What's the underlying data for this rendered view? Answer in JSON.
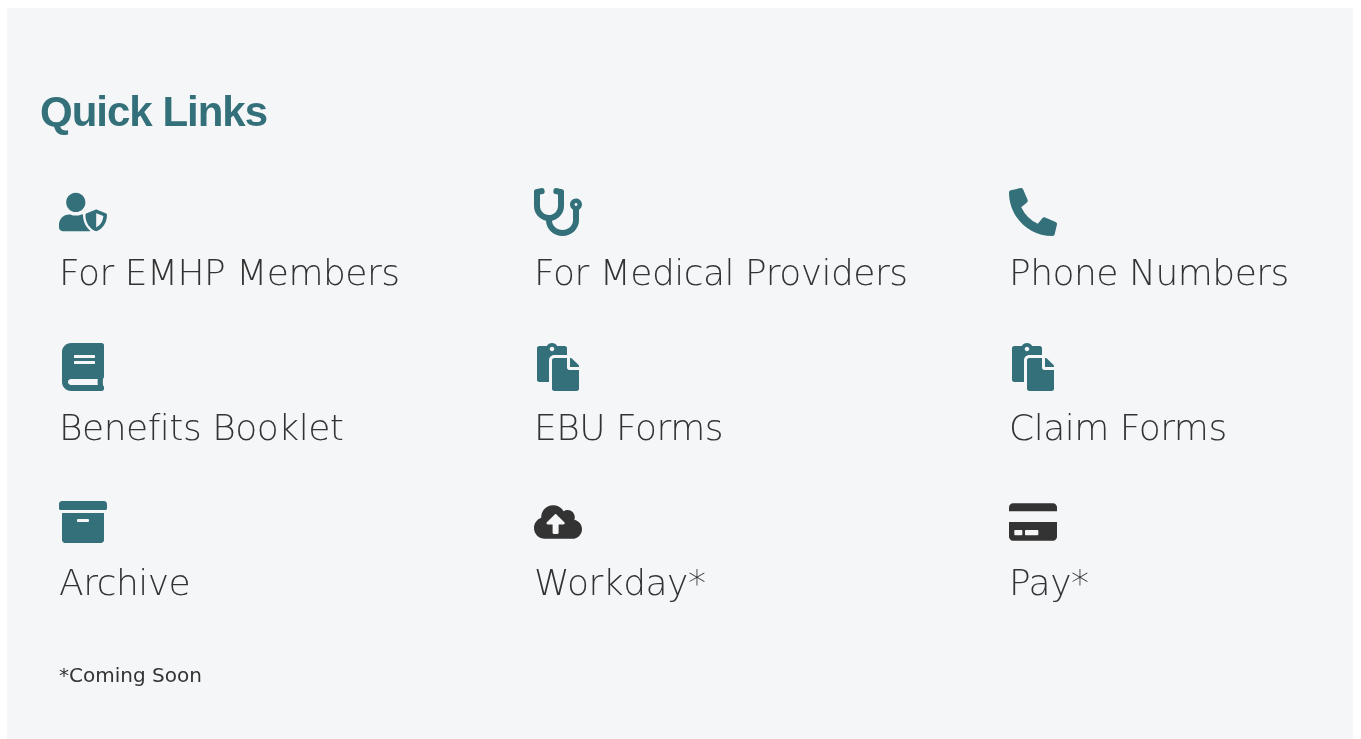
{
  "title": "Quick Links",
  "links": [
    {
      "label": "For EMHP Members",
      "kind": "user-shield",
      "color": "#33707a"
    },
    {
      "label": "For Medical Providers",
      "kind": "stethoscope",
      "color": "#33707a"
    },
    {
      "label": "Phone Numbers",
      "kind": "phone",
      "color": "#33707a"
    },
    {
      "label": "Benefits Booklet",
      "kind": "book",
      "color": "#33707a"
    },
    {
      "label": "EBU Forms",
      "kind": "clipboard",
      "color": "#33707a"
    },
    {
      "label": "Claim Forms",
      "kind": "clipboard",
      "color": "#33707a"
    },
    {
      "label": "Archive",
      "kind": "archive",
      "color": "#33707a"
    },
    {
      "label": "Workday*",
      "kind": "upload",
      "color": "#333333"
    },
    {
      "label": "Pay*",
      "kind": "card",
      "color": "#333333"
    }
  ],
  "footnote": "*Coming Soon"
}
